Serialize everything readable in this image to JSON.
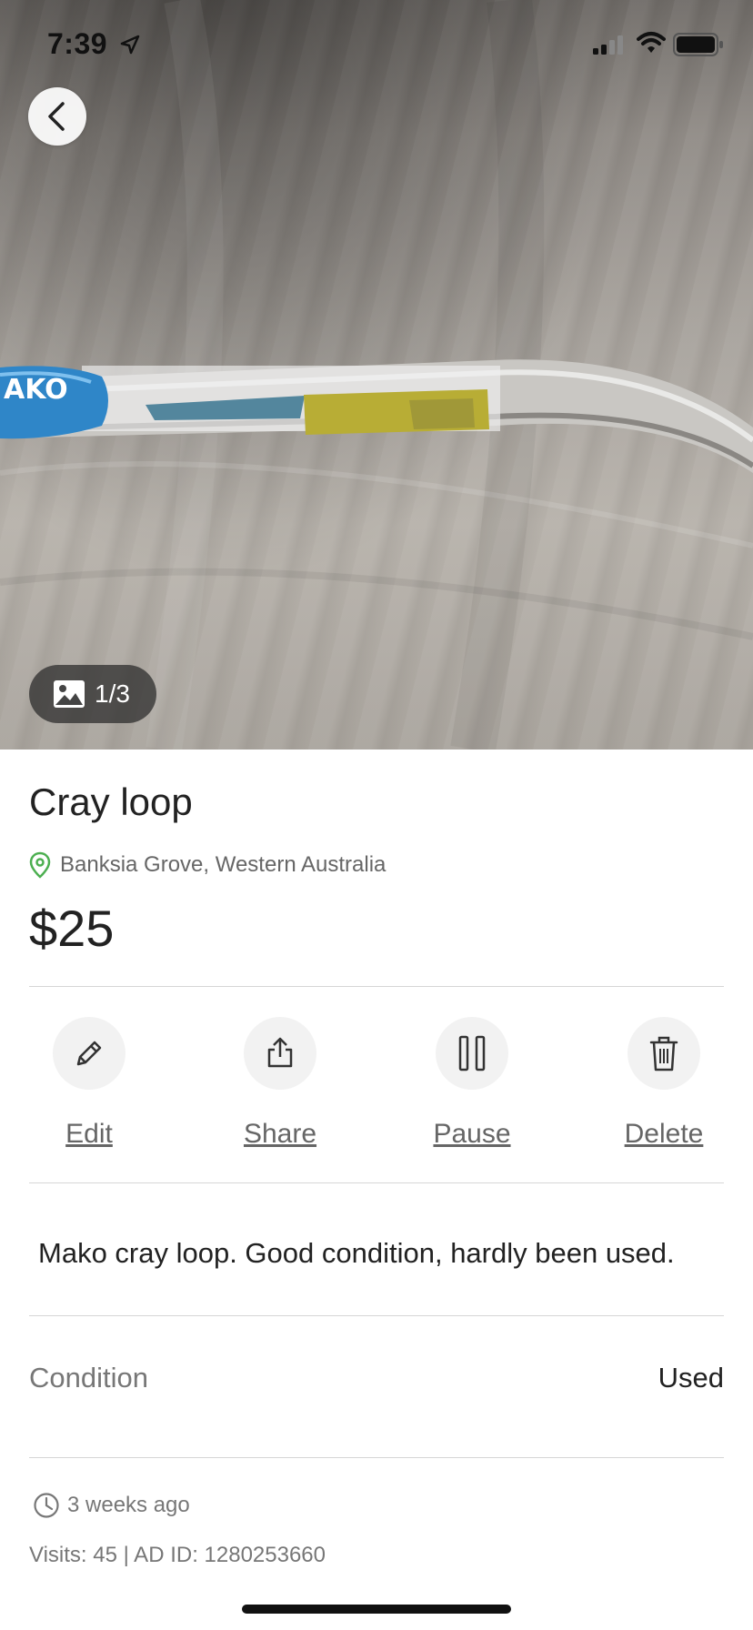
{
  "status_bar": {
    "time": "7:39"
  },
  "listing": {
    "image_counter": "1/3",
    "title": "Cray loop",
    "location": "Banksia Grove, Western Australia",
    "price": "$25",
    "description": "Mako cray loop. Good condition, hardly been used.",
    "condition_label": "Condition",
    "condition_value": "Used",
    "posted": "3 weeks ago",
    "meta": "Visits: 45 | AD ID: 1280253660"
  },
  "actions": {
    "edit": "Edit",
    "share": "Share",
    "pause": "Pause",
    "delete": "Delete"
  },
  "photo": {
    "brand_text": "AKO"
  },
  "colors": {
    "location_pin": "#4caf50",
    "label_gray": "#666666"
  }
}
